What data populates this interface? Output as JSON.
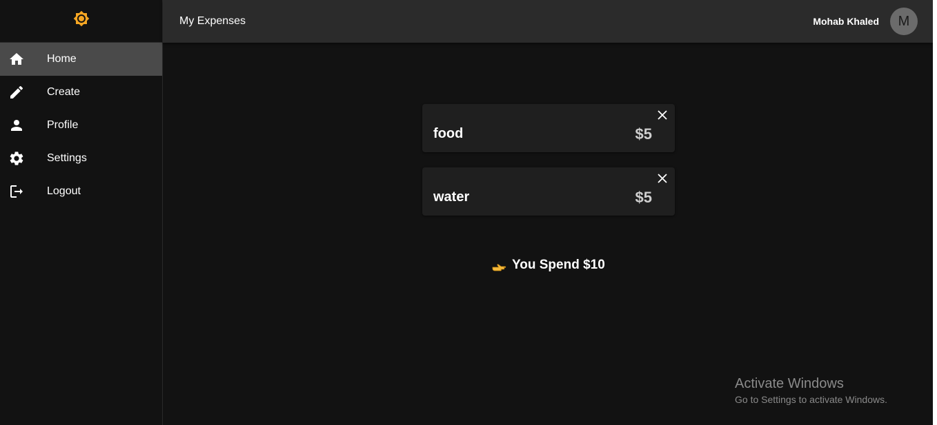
{
  "app": {
    "logo_icon": "brightness-icon",
    "accent_color": "#f5a623"
  },
  "header": {
    "title": "My Expenses",
    "user_name": "Mohab Khaled",
    "avatar_initial": "M"
  },
  "sidebar": {
    "items": [
      {
        "label": "Home",
        "icon": "home-icon",
        "active": true
      },
      {
        "label": "Create",
        "icon": "pencil-icon",
        "active": false
      },
      {
        "label": "Profile",
        "icon": "person-icon",
        "active": false
      },
      {
        "label": "Settings",
        "icon": "gear-icon",
        "active": false
      },
      {
        "label": "Logout",
        "icon": "logout-icon",
        "active": false
      }
    ]
  },
  "expenses": [
    {
      "name": "food",
      "amount": "$5"
    },
    {
      "name": "water",
      "amount": "$5"
    }
  ],
  "summary": {
    "text": "You Spend $10",
    "icon": "pointing-hand-icon"
  },
  "watermark": {
    "title": "Activate Windows",
    "subtitle": "Go to Settings to activate Windows."
  }
}
